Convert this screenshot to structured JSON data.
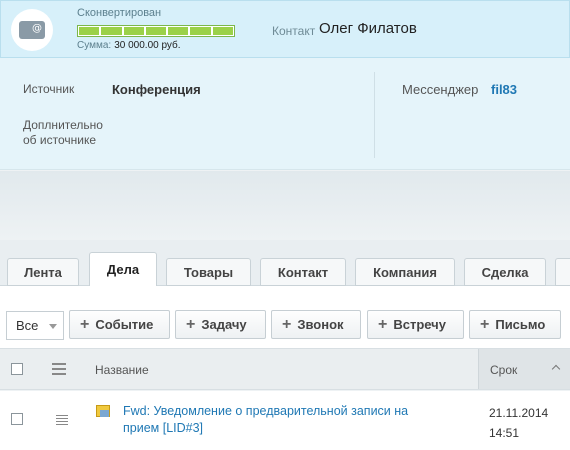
{
  "header": {
    "status": "Сконвертирован",
    "progress_segments": 7,
    "sum_label": "Сумма:",
    "sum_value": "30 000.00 руб.",
    "contact_label": "Контакт",
    "contact_name": "Олег Филатов",
    "avatar_icon": "contact-card-icon"
  },
  "details": {
    "source_label": "Источник",
    "source_value": "Конференция",
    "extra_label_line1": "Доплнительно",
    "extra_label_line2": "об источнике",
    "messenger_label": "Мессенджер",
    "messenger_value": "fil83"
  },
  "tabs": [
    {
      "label": "Лента"
    },
    {
      "label": "Дела"
    },
    {
      "label": "Товары"
    },
    {
      "label": "Контакт"
    },
    {
      "label": "Компания"
    },
    {
      "label": "Сделка"
    }
  ],
  "toolbar": {
    "filter_value": "Все",
    "buttons": [
      {
        "label": "Событие"
      },
      {
        "label": "Задачу"
      },
      {
        "label": "Звонок"
      },
      {
        "label": "Встречу"
      },
      {
        "label": "Письмо"
      }
    ]
  },
  "table": {
    "col_name": "Название",
    "col_deadline": "Срок",
    "rows": [
      {
        "title": "Fwd: Уведомление о предварительной записи на прием [LID#3]",
        "date": "21.11.2014",
        "time": "14:51",
        "icon": "email-icon"
      }
    ]
  },
  "colors": {
    "header_bg": "#d7f0fa",
    "progress": "#9bd149",
    "link": "#1f78b4"
  }
}
